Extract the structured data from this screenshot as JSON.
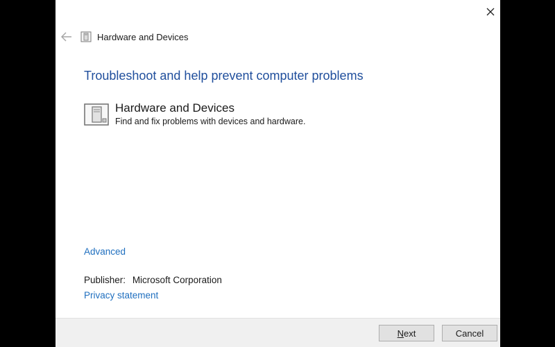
{
  "window": {
    "title": "Hardware and Devices",
    "close_label": "✕"
  },
  "main": {
    "heading": "Troubleshoot and help prevent computer problems",
    "item": {
      "title": "Hardware and Devices",
      "description": "Find and fix problems with devices and hardware."
    },
    "advanced_link": "Advanced",
    "publisher_label": "Publisher:",
    "publisher_value": "Microsoft Corporation",
    "privacy_link": "Privacy statement"
  },
  "footer": {
    "next_underlined": "N",
    "next_rest": "ext",
    "cancel_label": "Cancel"
  },
  "icons": {
    "back": "back-arrow-icon",
    "app_small": "troubleshooter-icon",
    "app_large": "hardware-devices-icon",
    "close": "close-icon"
  },
  "colors": {
    "heading": "#1f4e9c",
    "link": "#1f6fbf",
    "footer_bg": "#f0f0f0",
    "window_bg": "#ffffff",
    "outside_bg": "#000000"
  }
}
